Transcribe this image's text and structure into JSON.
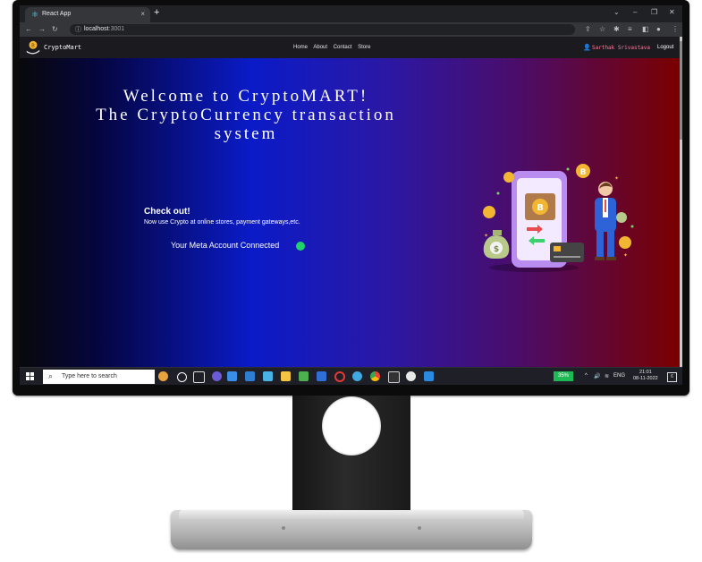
{
  "browser": {
    "tab_title": "React App",
    "tab_close": "×",
    "new_tab": "+",
    "url_host": "localhost",
    "url_port": ":3001",
    "window_controls": [
      "⌄",
      "–",
      "❐",
      "✕"
    ]
  },
  "site": {
    "brand": "CryptoMart",
    "nav": [
      "Home",
      "About",
      "Contact",
      "Store"
    ],
    "user": "Sarthak Srivastava",
    "logout": "Logout",
    "hero": {
      "title_lines": [
        "Welcome to CryptoMART!",
        "The CryptoCurrency transaction",
        "system"
      ],
      "check_heading": "Check out!",
      "check_body": "Now use Crypto at online stores, payment gateways,etc.",
      "meta_status": "Your Meta Account Connected",
      "status_color": "#1fd36b"
    }
  },
  "taskbar": {
    "search_placeholder": "Type here to search",
    "battery_pct": "35%",
    "lang": "ENG",
    "time": "21:01",
    "date": "08-11-2022",
    "notification_count": "6"
  },
  "colors": {
    "hero_gradient": [
      "#08080c",
      "#050540",
      "#0a1bc7",
      "#2a18a6",
      "#4a0d6b",
      "#7a0000"
    ],
    "user_color": "#ff7aa0"
  }
}
